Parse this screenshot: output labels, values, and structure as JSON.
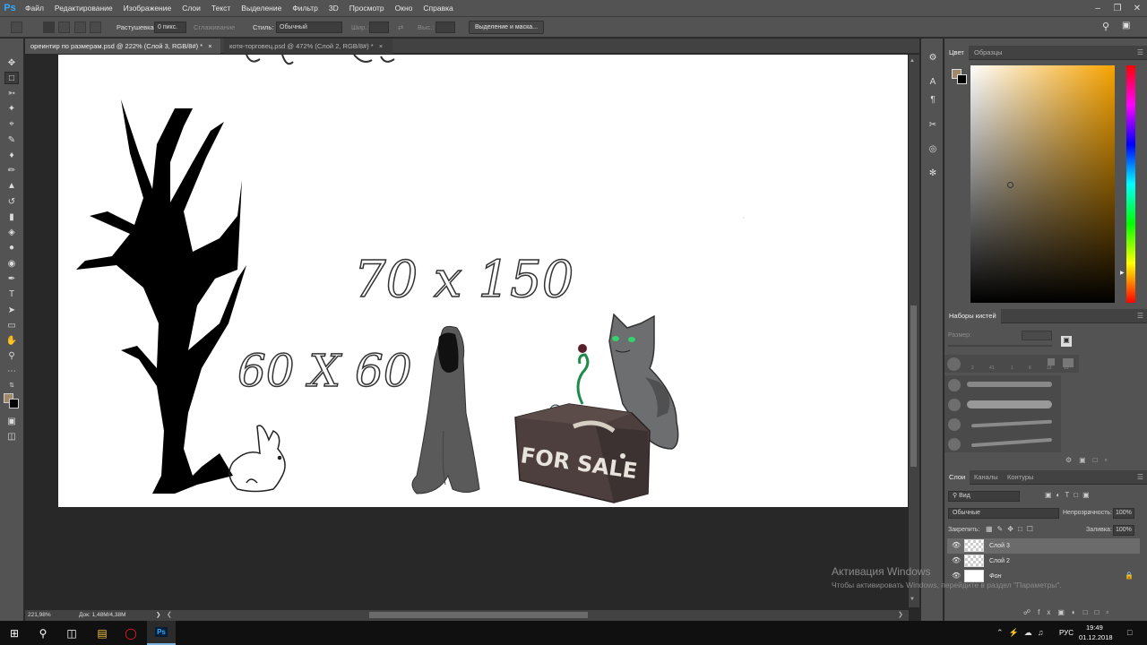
{
  "app": {
    "logo": "Ps"
  },
  "menu": [
    "Файл",
    "Редактирование",
    "Изображение",
    "Слои",
    "Текст",
    "Выделение",
    "Фильтр",
    "3D",
    "Просмотр",
    "Окно",
    "Справка"
  ],
  "options": {
    "feather_label": "Растушевка:",
    "feather_value": "0 пикс.",
    "antialias_label": "Сглаживание",
    "style_label": "Стиль:",
    "style_value": "Обычный",
    "width_label": "Шир.:",
    "height_label": "Выс.:",
    "select_mask_button": "Выделение и маска..."
  },
  "tabs": [
    {
      "label": "ореинтир по размерам.psd @ 222% (Слой 3, RGB/8#) *",
      "close": "×"
    },
    {
      "label": "котя-торговец.psd @ 472% (Слой 2, RGB/8#) *",
      "close": "×"
    }
  ],
  "canvas_text": {
    "dim1": "70 x 150",
    "dim2": "60 X 60",
    "sign": "FOR SALE"
  },
  "status": {
    "zoom": "221,98%",
    "doc": "Док: 1,48M/4,38M"
  },
  "color_panel": {
    "tabs": [
      "Цвет",
      "Образцы"
    ],
    "fg_color": "#a0896b",
    "bg_color": "#000000"
  },
  "brush_panel": {
    "title": "Наборы кистей",
    "size_label": "Размер:",
    "brush_numbers": [
      "2",
      "41",
      "1",
      "6",
      "13",
      "19"
    ]
  },
  "layers_panel": {
    "tabs": [
      "Слои",
      "Каналы",
      "Контуры"
    ],
    "filter_value": "Вид",
    "blend_mode": "Обычные",
    "opacity_label": "Непрозрачность:",
    "opacity_value": "100%",
    "lock_label": "Закрепить:",
    "fill_label": "Заливка:",
    "fill_value": "100%",
    "layers": [
      {
        "name": "Слой 3",
        "selected": true
      },
      {
        "name": "Слой 2",
        "selected": false
      },
      {
        "name": "Фон",
        "selected": false
      }
    ]
  },
  "watermark": {
    "title": "Активация Windows",
    "subtitle": "Чтобы активировать Windows, перейдите в раздел \"Параметры\"."
  },
  "taskbar": {
    "lang": "РУС",
    "time": "19:49",
    "date": "01.12.2018"
  }
}
